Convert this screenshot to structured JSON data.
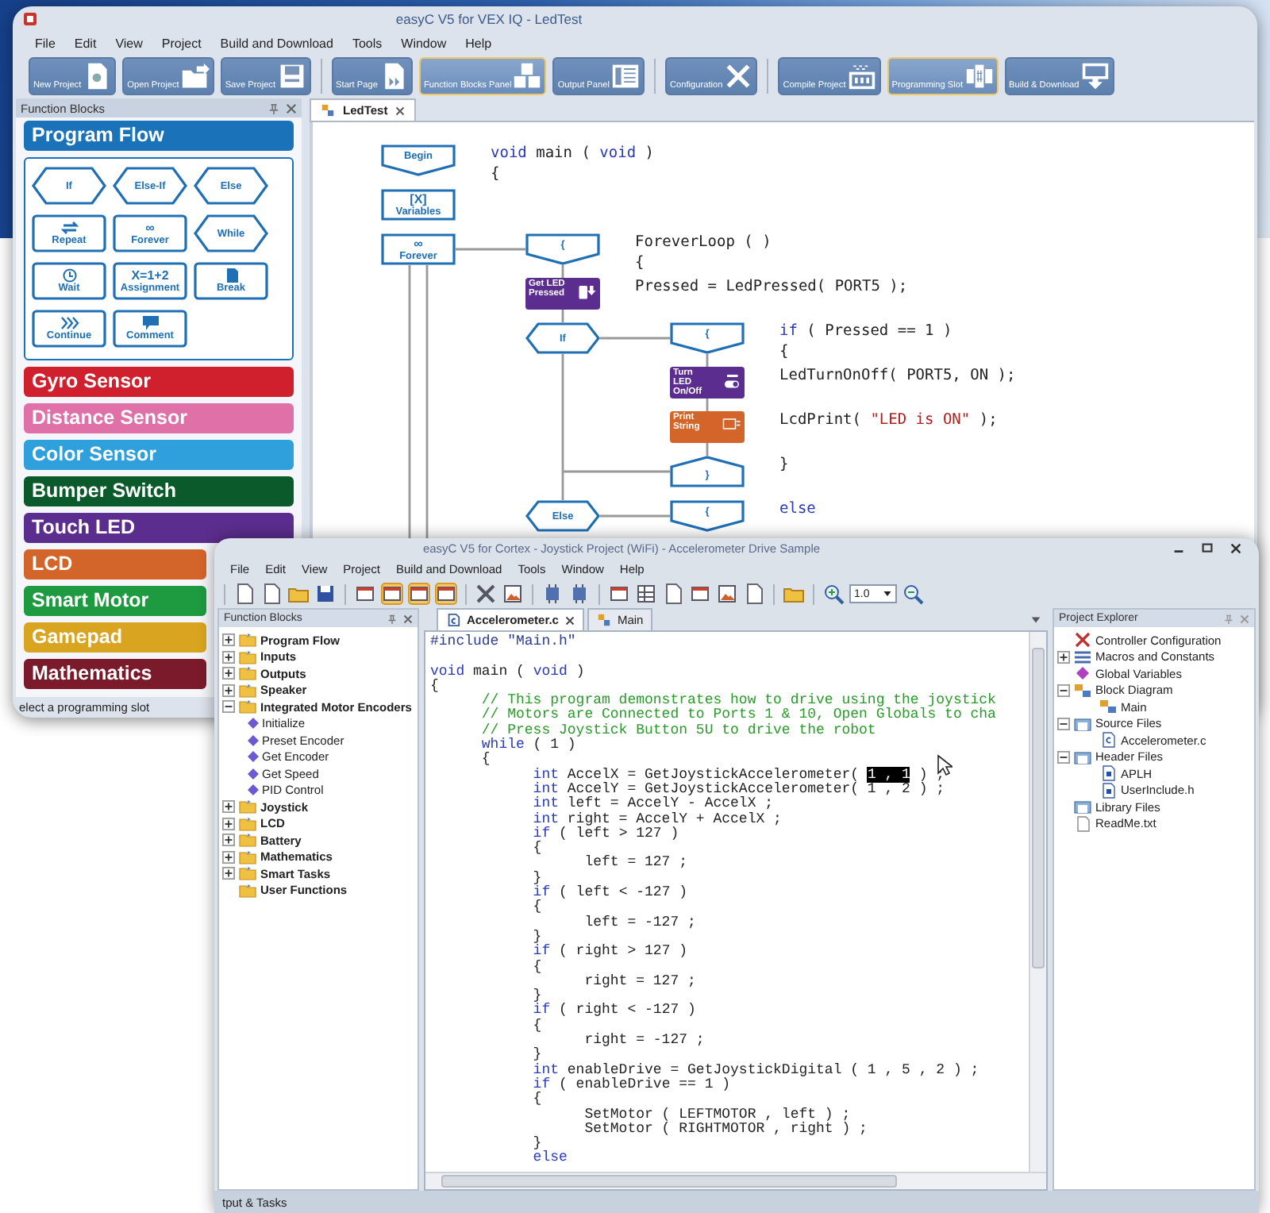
{
  "back_window": {
    "title": "easyC V5 for VEX IQ - LedTest",
    "menu": [
      "File",
      "Edit",
      "View",
      "Project",
      "Build and Download",
      "Tools",
      "Window",
      "Help"
    ],
    "toolbar": [
      [
        {
          "label": "New Project",
          "active": false
        },
        {
          "label": "Open Project",
          "active": false
        },
        {
          "label": "Save Project",
          "active": false
        }
      ],
      [
        {
          "label": "Start Page",
          "active": false
        },
        {
          "label": "Function Blocks Panel",
          "active": true
        },
        {
          "label": "Output Panel",
          "active": false
        }
      ],
      [
        {
          "label": "Configuration",
          "active": false
        }
      ],
      [
        {
          "label": "Compile Project",
          "active": false
        },
        {
          "label": "Programming Slot",
          "active": true
        },
        {
          "label": "Build & Download",
          "active": false
        }
      ]
    ],
    "panel": {
      "title": "Function Blocks",
      "categories": [
        {
          "label": "Program Flow",
          "color": "#1a72b9",
          "blocks": [
            {
              "label": "If",
              "kind": "hex"
            },
            {
              "label": "Else-If",
              "kind": "hex"
            },
            {
              "label": "Else",
              "kind": "hex"
            },
            {
              "label": "Repeat",
              "kind": "rect"
            },
            {
              "label": "Forever",
              "kind": "rect",
              "symbol": "∞"
            },
            {
              "label": "While",
              "kind": "hex"
            },
            {
              "label": "Wait",
              "kind": "rect"
            },
            {
              "label": "Assignment",
              "kind": "rect",
              "symbol": "X=1+2"
            },
            {
              "label": "Break",
              "kind": "rect"
            },
            {
              "label": "Continue",
              "kind": "rect"
            },
            {
              "label": "Comment",
              "kind": "rect"
            }
          ]
        },
        {
          "label": "Gyro Sensor",
          "color": "#d0202e"
        },
        {
          "label": "Distance Sensor",
          "color": "#e070a8"
        },
        {
          "label": "Color Sensor",
          "color": "#2fa0dc"
        },
        {
          "label": "Bumper Switch",
          "color": "#0b5a2b"
        },
        {
          "label": "Touch LED",
          "color": "#5b2d8e"
        },
        {
          "label": "LCD",
          "color": "#d4652a"
        },
        {
          "label": "Smart Motor",
          "color": "#1e9a40"
        },
        {
          "label": "Gamepad",
          "color": "#d9a520"
        },
        {
          "label": "Mathematics",
          "color": "#7a1a2a"
        }
      ]
    },
    "tabs": [
      {
        "label": "LedTest",
        "selected": true
      }
    ],
    "flowchart": [
      {
        "label": "Begin",
        "kind": "begin",
        "code": [
          [
            {
              "t": "void",
              "kind": "keyword"
            },
            {
              "t": " main ( ",
              "kind": "plain"
            },
            {
              "t": "void",
              "kind": "keyword"
            },
            {
              "t": " )",
              "kind": "plain"
            }
          ],
          [
            {
              "t": "{",
              "kind": "plain"
            }
          ]
        ]
      },
      {
        "label": "Variables",
        "kind": "block",
        "symbol": "[X]"
      },
      {
        "label": "Forever",
        "kind": "loop",
        "symbol": "∞",
        "body": [
          {
            "label": "{",
            "kind": "open",
            "code": [
              [
                {
                  "t": "ForeverLoop ( )",
                  "kind": "plain"
                }
              ],
              [
                {
                  "t": "{",
                  "kind": "plain"
                }
              ]
            ]
          },
          {
            "label": "Get LED Pressed",
            "kind": "function",
            "color": "#5b2d8e",
            "code": [
              [
                {
                  "t": "Pressed = LedPressed( PORT5 );",
                  "kind": "plain"
                }
              ]
            ]
          },
          {
            "label": "If",
            "kind": "hex",
            "body": [
              {
                "label": "{",
                "kind": "open",
                "code": [
                  [
                    {
                      "t": "if",
                      "kind": "keyword"
                    },
                    {
                      "t": " ( Pressed == 1 )",
                      "kind": "plain"
                    }
                  ],
                  [
                    {
                      "t": "{",
                      "kind": "plain"
                    }
                  ]
                ]
              },
              {
                "label": "Turn LED On/Off",
                "kind": "function",
                "color": "#5b2d8e",
                "code": [
                  [
                    {
                      "t": "LedTurnOnOff( PORT5, ON );",
                      "kind": "plain"
                    }
                  ]
                ]
              },
              {
                "label": "Print String",
                "kind": "function",
                "color": "#d4652a",
                "code": [
                  [
                    {
                      "t": "LcdPrint( ",
                      "kind": "plain"
                    },
                    {
                      "t": "\"LED is ON\"",
                      "kind": "string"
                    },
                    {
                      "t": " );",
                      "kind": "plain"
                    }
                  ]
                ]
              },
              {
                "label": "}",
                "kind": "close",
                "code": [
                  [
                    {
                      "t": "}",
                      "kind": "plain"
                    }
                  ]
                ]
              }
            ]
          },
          {
            "label": "Else",
            "kind": "hex",
            "body": [
              {
                "label": "{",
                "kind": "open",
                "code": [
                  [
                    {
                      "t": "else",
                      "kind": "keyword"
                    }
                  ]
                ]
              }
            ]
          }
        ]
      }
    ],
    "status": "elect a programming slot"
  },
  "front_window": {
    "title": "easyC V5 for Cortex - Joystick Project (WiFi) - Accelerometer Drive Sample",
    "menu": [
      "File",
      "Edit",
      "View",
      "Project",
      "Build and Download",
      "Tools",
      "Window",
      "Help"
    ],
    "toolbar": [
      [
        {
          "selected": false
        },
        {
          "selected": false
        },
        {
          "selected": false
        },
        {
          "selected": false
        }
      ],
      [
        {
          "selected": false
        },
        {
          "selected": true
        },
        {
          "selected": true
        },
        {
          "selected": true
        }
      ],
      [
        {
          "selected": false
        },
        {
          "selected": false
        }
      ],
      [
        {
          "selected": false
        },
        {
          "selected": false
        }
      ],
      [
        {
          "selected": false
        },
        {
          "selected": false
        },
        {
          "selected": false
        },
        {
          "selected": false
        },
        {
          "selected": false
        },
        {
          "selected": false
        }
      ],
      [
        {
          "selected": false
        }
      ]
    ],
    "zoom": "1.0",
    "function_blocks": {
      "title": "Function Blocks",
      "items": [
        {
          "label": "Program Flow",
          "expanded": false
        },
        {
          "label": "Inputs",
          "expanded": false
        },
        {
          "label": "Outputs",
          "expanded": false
        },
        {
          "label": "Speaker",
          "expanded": false
        },
        {
          "label": "Integrated Motor Encoders",
          "expanded": true,
          "children": [
            {
              "label": "Initialize"
            },
            {
              "label": "Preset Encoder"
            },
            {
              "label": "Get Encoder"
            },
            {
              "label": "Get Speed"
            },
            {
              "label": "PID Control"
            }
          ]
        },
        {
          "label": "Joystick",
          "expanded": false
        },
        {
          "label": "LCD",
          "expanded": false
        },
        {
          "label": "Battery",
          "expanded": false
        },
        {
          "label": "Mathematics",
          "expanded": false
        },
        {
          "label": "Smart Tasks",
          "expanded": false
        },
        {
          "label": "User Functions"
        }
      ]
    },
    "tabs": [
      {
        "label": "Accelerometer.c",
        "selected": true
      },
      {
        "label": "Main",
        "selected": false
      }
    ],
    "code": [
      {
        "segs": [
          {
            "t": "#include \"Main.h\"",
            "kind": "directive"
          }
        ]
      },
      {
        "blank_before": true,
        "segs": [
          {
            "t": "void",
            "kind": "keyword"
          },
          {
            "t": " main ( ",
            "kind": "plain"
          },
          {
            "t": "void",
            "kind": "keyword"
          },
          {
            "t": " )",
            "kind": "plain"
          }
        ]
      },
      {
        "segs": [
          {
            "t": "{",
            "kind": "plain"
          }
        ],
        "children": [
          {
            "segs": [
              {
                "t": "// This program demonstrates how to drive using the joystick",
                "kind": "comment"
              }
            ]
          },
          {
            "segs": [
              {
                "t": "// Motors are Connected to Ports 1 & 10, Open Globals to cha",
                "kind": "comment"
              }
            ]
          },
          {
            "segs": [
              {
                "t": "// Press Joystick Button 5U to drive the robot",
                "kind": "comment"
              }
            ]
          },
          {
            "segs": [
              {
                "t": "while",
                "kind": "keyword"
              },
              {
                "t": " ( 1 )",
                "kind": "plain"
              }
            ]
          },
          {
            "segs": [
              {
                "t": "{",
                "kind": "plain"
              }
            ],
            "children": [
              {
                "segs": [
                  {
                    "t": "int",
                    "kind": "keyword"
                  },
                  {
                    "t": " AccelX = GetJoystickAccelerometer( ",
                    "kind": "plain"
                  },
                  {
                    "t": "1 , 1",
                    "kind": "selection"
                  },
                  {
                    "t": " ) ;",
                    "kind": "plain"
                  }
                ]
              },
              {
                "segs": [
                  {
                    "t": "int",
                    "kind": "keyword"
                  },
                  {
                    "t": " AccelY = GetJoystickAccelerometer( 1 , 2 ) ;",
                    "kind": "plain"
                  }
                ]
              },
              {
                "segs": [
                  {
                    "t": "int",
                    "kind": "keyword"
                  },
                  {
                    "t": " left = AccelY - AccelX ;",
                    "kind": "plain"
                  }
                ]
              },
              {
                "segs": [
                  {
                    "t": "int",
                    "kind": "keyword"
                  },
                  {
                    "t": " right = AccelY + AccelX ;",
                    "kind": "plain"
                  }
                ]
              },
              {
                "segs": [
                  {
                    "t": "if",
                    "kind": "keyword"
                  },
                  {
                    "t": " ( left > 127 )",
                    "kind": "plain"
                  }
                ]
              },
              {
                "segs": [
                  {
                    "t": "{",
                    "kind": "plain"
                  }
                ],
                "children": [
                  {
                    "segs": [
                      {
                        "t": "left = 127 ;",
                        "kind": "plain"
                      }
                    ]
                  }
                ]
              },
              {
                "segs": [
                  {
                    "t": "}",
                    "kind": "plain"
                  }
                ]
              },
              {
                "segs": [
                  {
                    "t": "if",
                    "kind": "keyword"
                  },
                  {
                    "t": " ( left < -127 )",
                    "kind": "plain"
                  }
                ]
              },
              {
                "segs": [
                  {
                    "t": "{",
                    "kind": "plain"
                  }
                ],
                "children": [
                  {
                    "segs": [
                      {
                        "t": "left = -127 ;",
                        "kind": "plain"
                      }
                    ]
                  }
                ]
              },
              {
                "segs": [
                  {
                    "t": "}",
                    "kind": "plain"
                  }
                ]
              },
              {
                "segs": [
                  {
                    "t": "if",
                    "kind": "keyword"
                  },
                  {
                    "t": " ( right > 127 )",
                    "kind": "plain"
                  }
                ]
              },
              {
                "segs": [
                  {
                    "t": "{",
                    "kind": "plain"
                  }
                ],
                "children": [
                  {
                    "segs": [
                      {
                        "t": "right = 127 ;",
                        "kind": "plain"
                      }
                    ]
                  }
                ]
              },
              {
                "segs": [
                  {
                    "t": "}",
                    "kind": "plain"
                  }
                ]
              },
              {
                "segs": [
                  {
                    "t": "if",
                    "kind": "keyword"
                  },
                  {
                    "t": " ( right < -127 )",
                    "kind": "plain"
                  }
                ]
              },
              {
                "segs": [
                  {
                    "t": "{",
                    "kind": "plain"
                  }
                ],
                "children": [
                  {
                    "segs": [
                      {
                        "t": "right = -127 ;",
                        "kind": "plain"
                      }
                    ]
                  }
                ]
              },
              {
                "segs": [
                  {
                    "t": "}",
                    "kind": "plain"
                  }
                ]
              },
              {
                "segs": [
                  {
                    "t": "int",
                    "kind": "keyword"
                  },
                  {
                    "t": " enableDrive = GetJoystickDigital ( 1 , 5 , 2 ) ;",
                    "kind": "plain"
                  }
                ]
              },
              {
                "segs": [
                  {
                    "t": "if",
                    "kind": "keyword"
                  },
                  {
                    "t": " ( enableDrive == 1 )",
                    "kind": "plain"
                  }
                ]
              },
              {
                "segs": [
                  {
                    "t": "{",
                    "kind": "plain"
                  }
                ],
                "children": [
                  {
                    "segs": [
                      {
                        "t": "SetMotor ( LEFTMOTOR , left ) ;",
                        "kind": "plain"
                      }
                    ]
                  },
                  {
                    "segs": [
                      {
                        "t": "SetMotor ( RIGHTMOTOR , right ) ;",
                        "kind": "plain"
                      }
                    ]
                  }
                ]
              },
              {
                "segs": [
                  {
                    "t": "}",
                    "kind": "plain"
                  }
                ]
              },
              {
                "segs": [
                  {
                    "t": "else",
                    "kind": "keyword"
                  }
                ]
              }
            ]
          }
        ]
      }
    ],
    "explorer": {
      "title": "Project Explorer",
      "items": [
        {
          "label": "Controller Configuration"
        },
        {
          "label": "Macros and Constants",
          "expanded": false
        },
        {
          "label": "Global Variables"
        },
        {
          "label": "Block Diagram",
          "expanded": true,
          "children": [
            {
              "label": "Main"
            }
          ]
        },
        {
          "label": "Source Files",
          "expanded": true,
          "children": [
            {
              "label": "Accelerometer.c"
            }
          ]
        },
        {
          "label": "Header Files",
          "expanded": true,
          "children": [
            {
              "label": "APLH"
            },
            {
              "label": "UserInclude.h"
            }
          ]
        },
        {
          "label": "Library Files"
        },
        {
          "label": "ReadMe.txt"
        }
      ]
    },
    "output_panel": "tput & Tasks"
  }
}
